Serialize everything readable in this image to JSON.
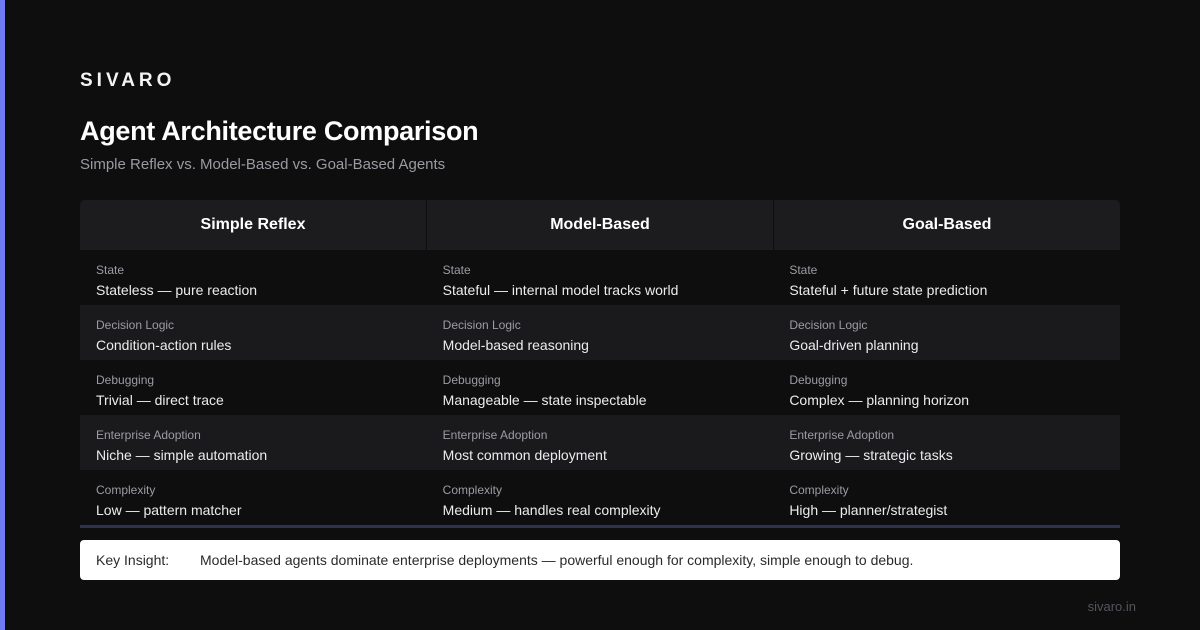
{
  "brand": "SIVARO",
  "title": "Agent Architecture Comparison",
  "subtitle": "Simple Reflex vs. Model-Based vs. Goal-Based Agents",
  "columns": [
    "Simple Reflex",
    "Model-Based",
    "Goal-Based"
  ],
  "rows": [
    {
      "label": "State",
      "values": [
        "Stateless — pure reaction",
        "Stateful — internal model tracks world",
        "Stateful + future state prediction"
      ]
    },
    {
      "label": "Decision Logic",
      "values": [
        "Condition-action rules",
        "Model-based reasoning",
        "Goal-driven planning"
      ]
    },
    {
      "label": "Debugging",
      "values": [
        "Trivial — direct trace",
        "Manageable — state inspectable",
        "Complex — planning horizon"
      ]
    },
    {
      "label": "Enterprise Adoption",
      "values": [
        "Niche — simple automation",
        "Most common deployment",
        "Growing — strategic tasks"
      ]
    },
    {
      "label": "Complexity",
      "values": [
        "Low — pattern matcher",
        "Medium — handles real complexity",
        "High — planner/strategist"
      ]
    }
  ],
  "insight": {
    "label": "Key Insight:",
    "text": "Model-based agents dominate enterprise deployments — powerful enough for complexity, simple enough to debug."
  },
  "footer": "sivaro.in",
  "colors": {
    "accent": "#6f7bf0",
    "background": "#0e0e0f",
    "header_bg": "#1c1c1f",
    "row_alt_bg": "#1a1a1d",
    "rule": "#2c3350",
    "insight_bg": "#ffffff"
  }
}
